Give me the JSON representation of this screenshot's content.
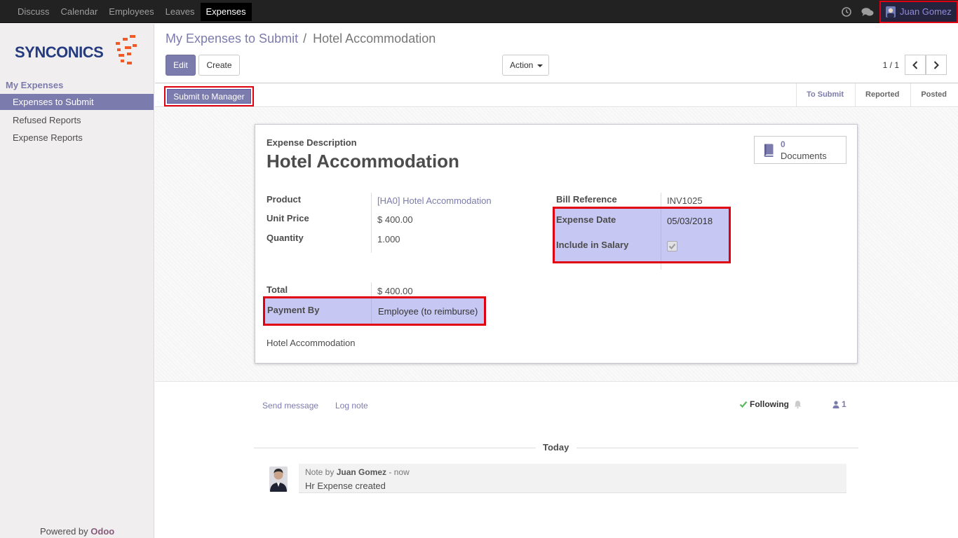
{
  "topbar": {
    "menu": [
      "Discuss",
      "Calendar",
      "Employees",
      "Leaves",
      "Expenses"
    ],
    "user": "Juan Gomez"
  },
  "sidebar": {
    "logo_text": "SYNCONICS",
    "section": "My Expenses",
    "items": [
      "Expenses to Submit",
      "Refused Reports",
      "Expense Reports"
    ],
    "powered_prefix": "Powered by ",
    "powered_brand": "Odoo"
  },
  "breadcrumb": {
    "parent": "My Expenses to Submit",
    "separator": "/",
    "current": "Hotel Accommodation"
  },
  "buttons": {
    "edit": "Edit",
    "create": "Create",
    "action": "Action"
  },
  "pager": {
    "value": "1 / 1"
  },
  "status": {
    "submit": "Submit to Manager",
    "stages": [
      "To Submit",
      "Reported",
      "Posted"
    ],
    "current_stage": "To Submit"
  },
  "form": {
    "desc_label": "Expense Description",
    "title": "Hotel Accommodation",
    "docs_count": "0",
    "docs_label": "Documents",
    "product_label": "Product",
    "product_value": "[HA0] Hotel Accommodation",
    "unit_price_label": "Unit Price",
    "unit_price_value": "$ 400.00",
    "quantity_label": "Quantity",
    "quantity_value": "1.000",
    "total_label": "Total",
    "total_value": "$ 400.00",
    "payment_label": "Payment By",
    "payment_value": "Employee (to reimburse)",
    "bill_ref_label": "Bill Reference",
    "bill_ref_value": "INV1025",
    "expense_date_label": "Expense Date",
    "expense_date_value": "05/03/2018",
    "include_salary_label": "Include in Salary",
    "include_salary_checked": true,
    "notes": "Hotel Accommodation"
  },
  "chatter": {
    "send_message": "Send message",
    "log_note": "Log note",
    "following": "Following",
    "followers": "1",
    "day": "Today",
    "note_prefix": "Note by",
    "author": "Juan Gomez",
    "time": "- now",
    "body": "Hr Expense created"
  },
  "colors": {
    "brand": "#7c7bad",
    "highlight": "#c7c7f4",
    "annotation": "#e0000f",
    "success": "#5cb85c"
  }
}
